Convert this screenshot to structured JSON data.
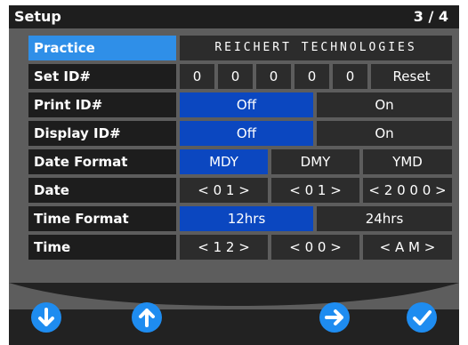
{
  "header": {
    "title": "Setup",
    "page": "3 / 4"
  },
  "practice": {
    "label": "Practice",
    "value": "REICHERT TECHNOLOGIES"
  },
  "set_id": {
    "label": "Set ID#",
    "digits": [
      "0",
      "0",
      "0",
      "0",
      "0"
    ],
    "reset": "Reset"
  },
  "print_id": {
    "label": "Print ID#",
    "off": "Off",
    "on": "On",
    "selected": "Off"
  },
  "display_id": {
    "label": "Display ID#",
    "off": "Off",
    "on": "On",
    "selected": "Off"
  },
  "date_format": {
    "label": "Date Format",
    "options": [
      "MDY",
      "DMY",
      "YMD"
    ],
    "selected": "MDY"
  },
  "date": {
    "label": "Date",
    "month": "< 0 1 >",
    "day": "< 0 1 >",
    "year": "< 2 0 0 0 >"
  },
  "time_format": {
    "label": "Time Format",
    "options": [
      "12hrs",
      "24hrs"
    ],
    "selected": "12hrs"
  },
  "time": {
    "label": "Time",
    "hour": "< 1 2 >",
    "minute": "< 0 0 >",
    "ampm": "< A M >"
  },
  "footer": {
    "icons": [
      "arrow-down-icon",
      "arrow-up-icon",
      "arrow-right-icon",
      "checkmark-icon"
    ]
  },
  "colors": {
    "selected": "#0b47c0",
    "active_label": "#2f8fe8",
    "button": "#1e8cf0"
  }
}
